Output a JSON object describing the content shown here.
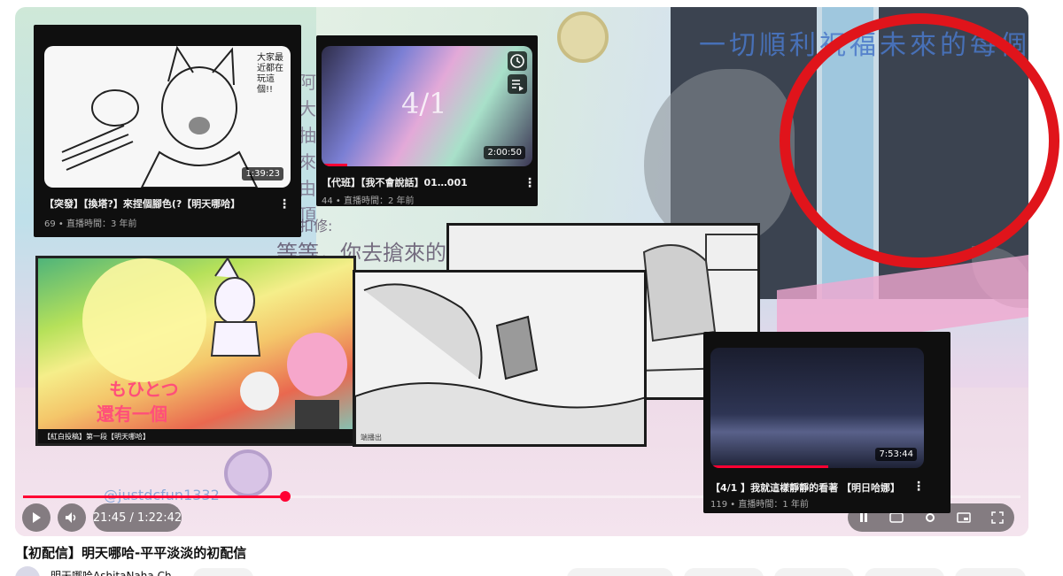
{
  "player": {
    "overlay_banner": "一切順利祝福未來的每個",
    "overlay_chat_lines": [
      "阿",
      "大",
      "抽",
      "來",
      "由",
      "頂"
    ],
    "overlay_subtitle": "等等，你去搶來的",
    "overlay_chat_name": "扣扣修:",
    "handle": "@justdcfun1332",
    "time_current": "21:45",
    "time_total": "1:22:42",
    "progress_fraction": 0.263
  },
  "cards": [
    {
      "title": "【突發】【換塔?】來捏個腳色(?【明天哪哈】",
      "meta": "69 • 直播時間：3 年前",
      "duration": "1:39:23",
      "sketch_text": "大家最近都在玩這個!!"
    },
    {
      "title": "【代班】【我不會說話】01…001",
      "meta": "44 • 直播時間：2 年前",
      "duration": "2:00:50",
      "art_text": "4/1"
    },
    {
      "title": "【4/1 】我就這樣靜靜的看著 【明日哈娜】",
      "meta": "119 • 直播時間：1 年前",
      "duration": "7:53:44"
    }
  ],
  "shots": {
    "anime_caption": "【紅白投稿】第一段【明天哪哈】",
    "anime_line1": "もひとつ",
    "anime_line2": "還有一個",
    "sketch_caption": "端播出"
  },
  "video": {
    "title": "【初配信】明天哪哈-平平淡淡的初配信",
    "channel": "明天哪哈AshitaNaha Ch."
  },
  "colors": {
    "accent_red": "#ff0033",
    "annotation_red": "#e0141b",
    "card_bg": "#0f0f0f"
  },
  "icons": [
    "play-icon",
    "volume-icon",
    "pause-icon",
    "subtitles-icon",
    "settings-icon",
    "miniplayer-icon",
    "fullscreen-icon",
    "kebab-icon",
    "watch-later-icon",
    "add-to-queue-icon"
  ]
}
